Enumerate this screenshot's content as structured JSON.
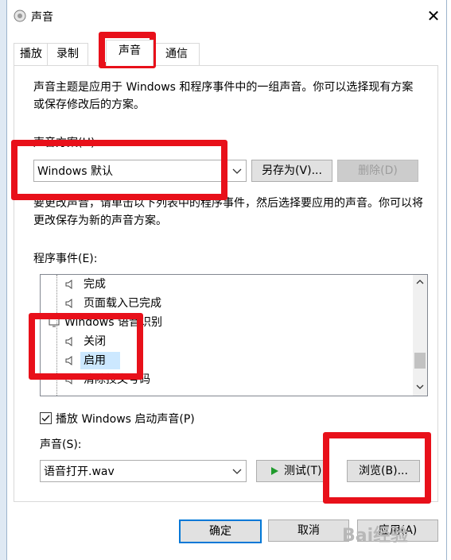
{
  "window": {
    "title": "声音"
  },
  "tabs": [
    {
      "label": "播放"
    },
    {
      "label": "录制"
    },
    {
      "label": "声音"
    },
    {
      "label": "通信"
    }
  ],
  "description": "声音主题是应用于 Windows 和程序事件中的一组声音。你可以选择现有方案或保存修改后的方案。",
  "scheme": {
    "label": "声音方案(H):",
    "value": "Windows 默认",
    "save_as_label": "另存为(V)...",
    "delete_label": "删除(D)"
  },
  "instruction": "要更改声音，请单击以下列表中的程序事件，然后选择要应用的声音。你可以将更改保存为新的声音方案。",
  "events": {
    "label": "程序事件(E):",
    "items": [
      {
        "label": "完成",
        "selected": false
      },
      {
        "label": "页面载入已完成",
        "selected": false
      },
      {
        "label": "Windows 语音识别",
        "group": true
      },
      {
        "label": "关闭",
        "selected": false
      },
      {
        "label": "启用",
        "selected": true
      },
      {
        "label": "清除技文号码",
        "selected": false
      }
    ]
  },
  "startup_sound": {
    "label": "播放 Windows 启动声音(P)",
    "checked": true
  },
  "sound": {
    "label": "声音(S):",
    "value": "语音打开.wav",
    "test_label": "测试(T)",
    "browse_label": "浏览(B)..."
  },
  "footer": {
    "ok_label": "确定",
    "cancel_label": "取消",
    "apply_label": "应用(A)"
  },
  "watermark": "Bai经验",
  "colors": {
    "highlight_red": "#e8101a",
    "selected_bg": "#cce8ff",
    "accent": "#0078d7",
    "play_green": "#1f9a2c"
  }
}
